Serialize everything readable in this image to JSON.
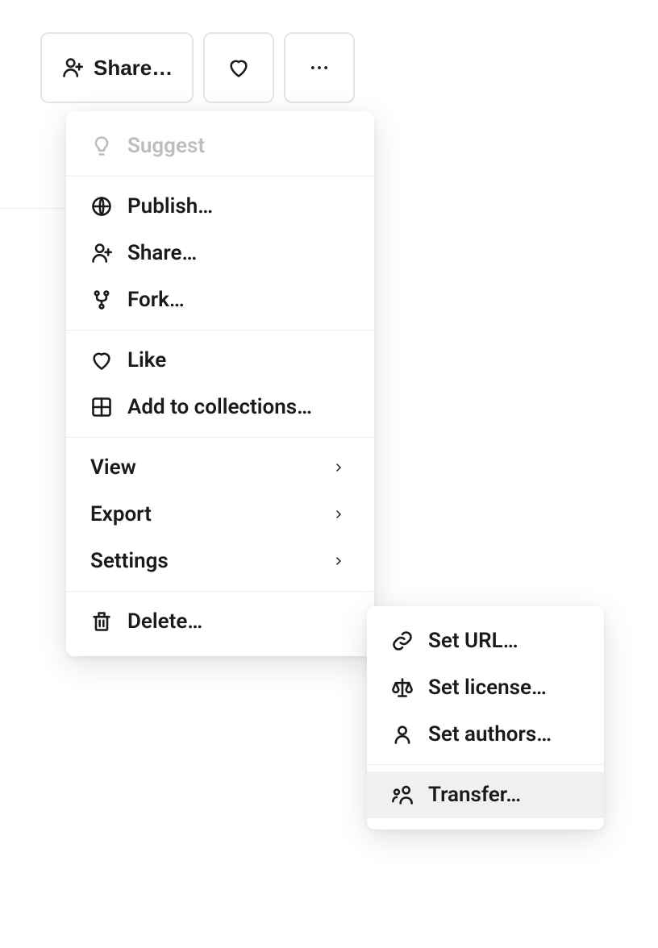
{
  "toolbar": {
    "share_label": "Share…"
  },
  "menu": {
    "suggest": "Suggest",
    "publish": "Publish…",
    "share": "Share…",
    "fork": "Fork…",
    "like": "Like",
    "add_to_collections": "Add to collections…",
    "view": "View",
    "export": "Export",
    "settings": "Settings",
    "delete": "Delete…"
  },
  "submenu": {
    "set_url": "Set URL…",
    "set_license": "Set license…",
    "set_authors": "Set authors…",
    "transfer": "Transfer…"
  }
}
